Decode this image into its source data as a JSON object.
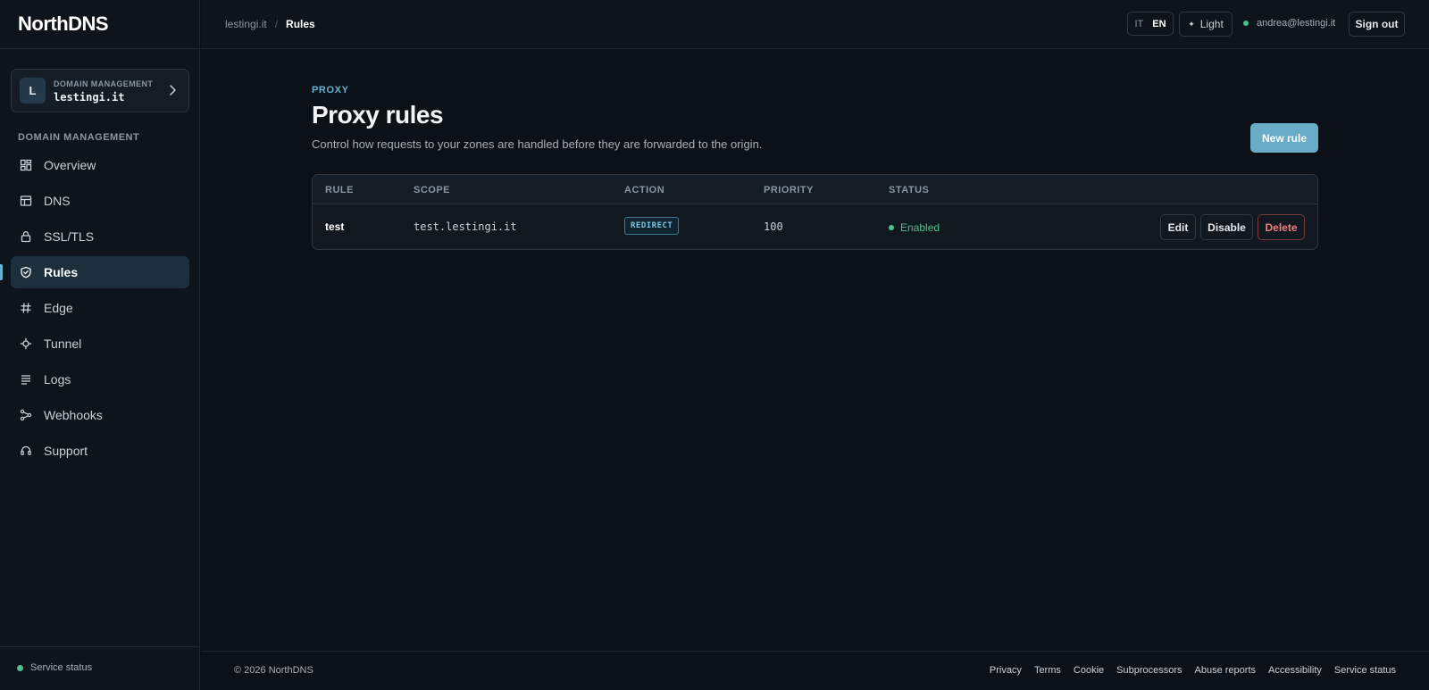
{
  "brand": {
    "name": "NorthDNS"
  },
  "sidebar": {
    "domain_card": {
      "avatar_letter": "L",
      "kicker": "DOMAIN MANAGEMENT",
      "domain": "lestingi.it"
    },
    "section_heading": "DOMAIN MANAGEMENT",
    "items": [
      {
        "label": "Overview",
        "icon": "grid-icon"
      },
      {
        "label": "DNS",
        "icon": "table-icon"
      },
      {
        "label": "SSL/TLS",
        "icon": "lock-icon"
      },
      {
        "label": "Rules",
        "icon": "shield-icon",
        "active": true
      },
      {
        "label": "Edge",
        "icon": "hash-icon"
      },
      {
        "label": "Tunnel",
        "icon": "crosshair-icon"
      },
      {
        "label": "Logs",
        "icon": "lines-icon"
      },
      {
        "label": "Webhooks",
        "icon": "share-icon"
      },
      {
        "label": "Support",
        "icon": "headset-icon"
      }
    ],
    "service_status": "Service status"
  },
  "topbar": {
    "breadcrumb": {
      "parent": "lestingi.it",
      "separator": "/",
      "current": "Rules"
    },
    "languages": [
      "IT",
      "EN"
    ],
    "active_language": "EN",
    "theme_toggle": "Light",
    "user_email": "andrea@lestingi.it",
    "sign_out": "Sign out"
  },
  "page": {
    "kicker": "PROXY",
    "title": "Proxy rules",
    "subtitle": "Control how requests to your zones are handled before they are forwarded to the origin.",
    "new_rule_button": "New rule"
  },
  "table": {
    "columns": [
      "RULE",
      "SCOPE",
      "ACTION",
      "PRIORITY",
      "STATUS"
    ],
    "rows": [
      {
        "rule": "test",
        "scope": "test.lestingi.it",
        "action": "REDIRECT",
        "priority": "100",
        "status": "Enabled",
        "actions": {
          "edit": "Edit",
          "disable": "Disable",
          "delete": "Delete"
        }
      }
    ]
  },
  "footer": {
    "copyright": "© 2026 NorthDNS",
    "links": [
      "Privacy",
      "Terms",
      "Cookie",
      "Subprocessors",
      "Abuse reports",
      "Accessibility",
      "Service status"
    ]
  },
  "colors": {
    "accent": "#69acc7",
    "success": "#4fc08d",
    "danger": "#f07f7f",
    "background": "#0c1117"
  }
}
